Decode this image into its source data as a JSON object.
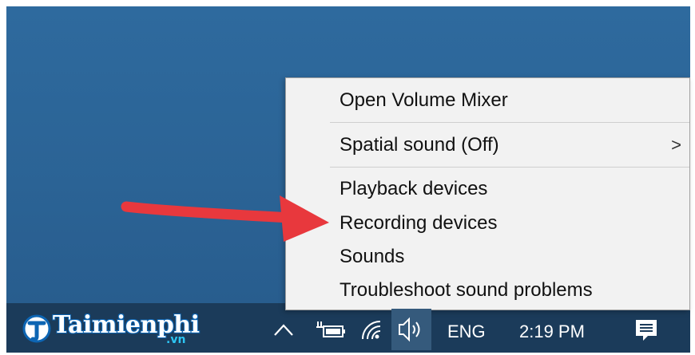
{
  "menu": {
    "items": [
      {
        "label": "Open Volume Mixer"
      },
      {
        "label": "Spatial sound (Off)",
        "submenu": ">"
      },
      {
        "label": "Playback devices"
      },
      {
        "label": "Recording devices"
      },
      {
        "label": "Sounds"
      },
      {
        "label": "Troubleshoot sound problems"
      }
    ]
  },
  "taskbar": {
    "logo_text": "Taimienphi",
    "logo_suffix": ".vn",
    "language": "ENG",
    "time": "2:19 PM"
  },
  "icons": {
    "chevron_up": "chevron-up-icon",
    "battery": "battery-icon",
    "wifi": "wifi-icon",
    "volume": "volume-icon",
    "notifications": "action-center-icon"
  },
  "colors": {
    "desktop": "#2b6395",
    "taskbar": "#1b3b5a",
    "menu_bg": "#f2f2f2",
    "arrow": "#e8383d"
  }
}
